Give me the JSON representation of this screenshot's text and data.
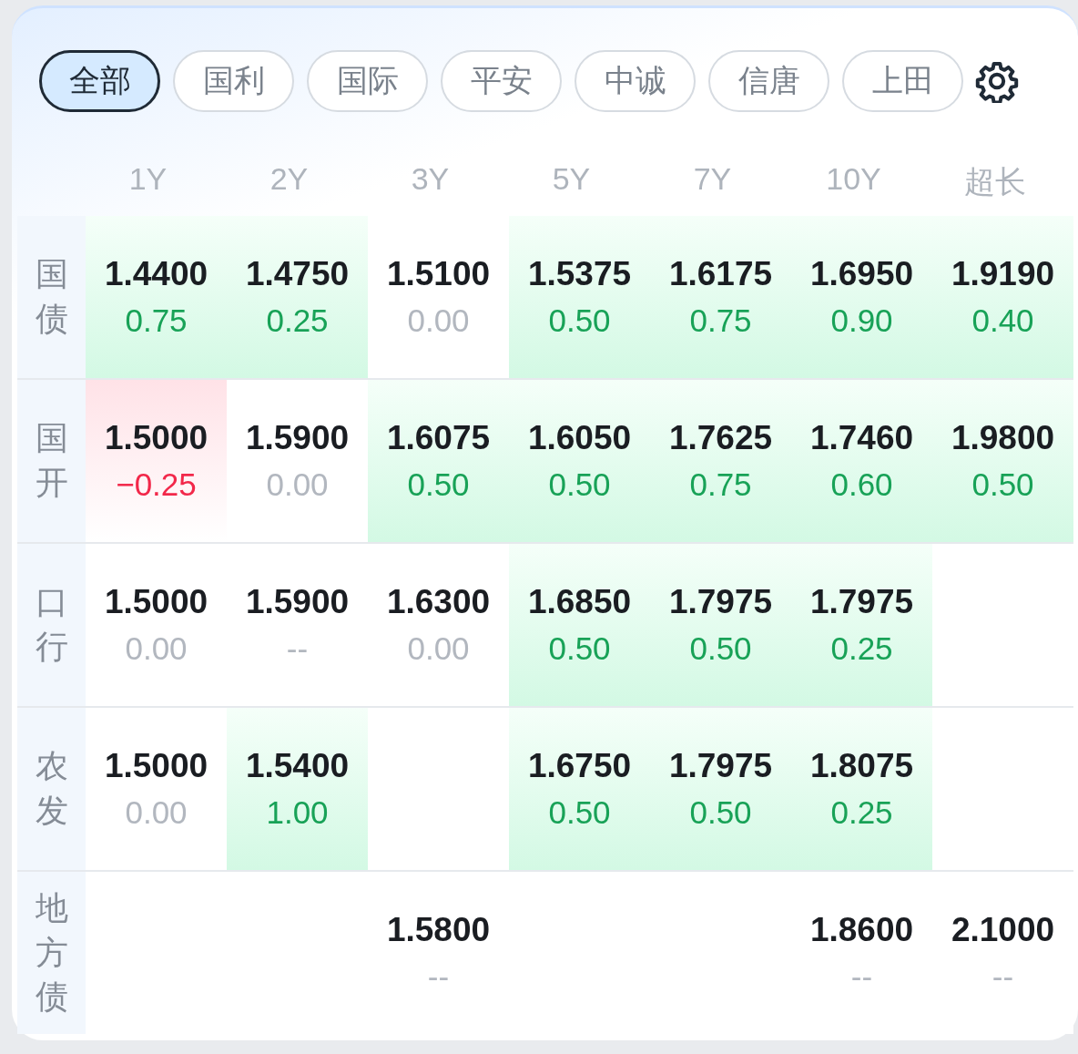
{
  "tabs": [
    {
      "label": "全部",
      "selected": true
    },
    {
      "label": "国利",
      "selected": false
    },
    {
      "label": "国际",
      "selected": false
    },
    {
      "label": "平安",
      "selected": false
    },
    {
      "label": "中诚",
      "selected": false
    },
    {
      "label": "信唐",
      "selected": false
    },
    {
      "label": "上田",
      "selected": false
    }
  ],
  "columns": [
    "1Y",
    "2Y",
    "3Y",
    "5Y",
    "7Y",
    "10Y",
    "超长"
  ],
  "rows": [
    {
      "label": "国债",
      "cells": [
        {
          "kind": "up",
          "value": "1.4400",
          "change": "0.75"
        },
        {
          "kind": "up",
          "value": "1.4750",
          "change": "0.25"
        },
        {
          "kind": "flat",
          "value": "1.5100",
          "change": "0.00"
        },
        {
          "kind": "up",
          "value": "1.5375",
          "change": "0.50"
        },
        {
          "kind": "up",
          "value": "1.6175",
          "change": "0.75"
        },
        {
          "kind": "up",
          "value": "1.6950",
          "change": "0.90"
        },
        {
          "kind": "up",
          "value": "1.9190",
          "change": "0.40"
        }
      ]
    },
    {
      "label": "国开",
      "cells": [
        {
          "kind": "down",
          "value": "1.5000",
          "change": "−0.25"
        },
        {
          "kind": "flat",
          "value": "1.5900",
          "change": "0.00"
        },
        {
          "kind": "up",
          "value": "1.6075",
          "change": "0.50"
        },
        {
          "kind": "up",
          "value": "1.6050",
          "change": "0.50"
        },
        {
          "kind": "up",
          "value": "1.7625",
          "change": "0.75"
        },
        {
          "kind": "up",
          "value": "1.7460",
          "change": "0.60"
        },
        {
          "kind": "up",
          "value": "1.9800",
          "change": "0.50"
        }
      ]
    },
    {
      "label": "口行",
      "cells": [
        {
          "kind": "flat",
          "value": "1.5000",
          "change": "0.00"
        },
        {
          "kind": "flat",
          "value": "1.5900",
          "change": "--"
        },
        {
          "kind": "flat",
          "value": "1.6300",
          "change": "0.00"
        },
        {
          "kind": "up",
          "value": "1.6850",
          "change": "0.50"
        },
        {
          "kind": "up",
          "value": "1.7975",
          "change": "0.50"
        },
        {
          "kind": "up",
          "value": "1.7975",
          "change": "0.25"
        },
        {
          "kind": "empty"
        }
      ]
    },
    {
      "label": "农发",
      "cells": [
        {
          "kind": "flat",
          "value": "1.5000",
          "change": "0.00"
        },
        {
          "kind": "up",
          "value": "1.5400",
          "change": "1.00"
        },
        {
          "kind": "empty"
        },
        {
          "kind": "up",
          "value": "1.6750",
          "change": "0.50"
        },
        {
          "kind": "up",
          "value": "1.7975",
          "change": "0.50"
        },
        {
          "kind": "up",
          "value": "1.8075",
          "change": "0.25"
        },
        {
          "kind": "empty"
        }
      ]
    },
    {
      "label": "地方债",
      "cells": [
        {
          "kind": "empty"
        },
        {
          "kind": "empty"
        },
        {
          "kind": "flat",
          "value": "1.5800",
          "change": "--"
        },
        {
          "kind": "empty"
        },
        {
          "kind": "empty"
        },
        {
          "kind": "flat",
          "value": "1.8600",
          "change": "--"
        },
        {
          "kind": "flat",
          "value": "2.1000",
          "change": "--"
        }
      ]
    }
  ]
}
